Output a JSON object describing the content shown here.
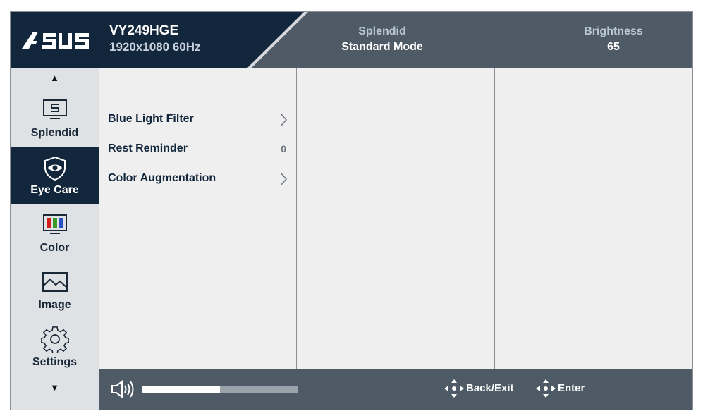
{
  "header": {
    "brand": "ASUS",
    "model": "VY249HGE",
    "resolution": "1920x1080 60Hz",
    "splendid_label": "Splendid",
    "splendid_value": "Standard Mode",
    "brightness_label": "Brightness",
    "brightness_value": "65"
  },
  "sidebar": {
    "items": [
      {
        "label": "Splendid",
        "icon": "splendid-monitor-icon"
      },
      {
        "label": "Eye Care",
        "icon": "eye-shield-icon"
      },
      {
        "label": "Color",
        "icon": "color-bars-icon"
      },
      {
        "label": "Image",
        "icon": "image-landscape-icon"
      },
      {
        "label": "Settings",
        "icon": "gear-icon"
      }
    ],
    "active": "Eye Care"
  },
  "menu": {
    "items": [
      {
        "label": "Blue Light Filter",
        "indicator": "chevron-right-icon"
      },
      {
        "label": "Rest Reminder",
        "value": "0"
      },
      {
        "label": "Color Augmentation",
        "indicator": "chevron-right-icon"
      }
    ]
  },
  "footer": {
    "volume_fraction": 0.5,
    "back_label": "Back/Exit",
    "enter_label": "Enter"
  },
  "colors": {
    "brand_navy": "#13273c",
    "header_gray": "#4e5a65",
    "panel": "#efefef",
    "sidebar": "#dfe2e5"
  }
}
